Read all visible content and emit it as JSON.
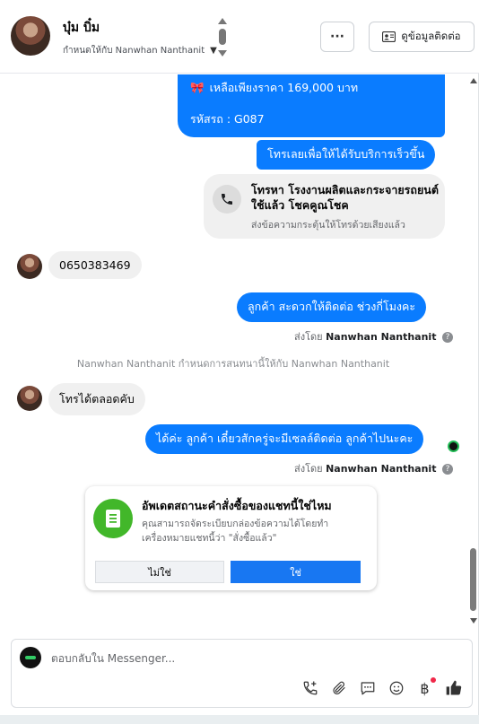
{
  "header": {
    "name": "บุ๋ม บิ๋ม",
    "assigned": "กำหนดให้กับ Nanwhan Nanthanit",
    "more_label": "···",
    "info_label": "ดูข้อมูลติดต่อ"
  },
  "messages": {
    "m1_line1": "เหลือเพียงราคา 169,000 บาท",
    "m1_line2": "รหัสรถ : G087",
    "m2": "โทรเลยเพื่อให้ได้รับบริการเร็วขึ้น",
    "call_title": "โทรหา โรงงานผลิตและกระจายรถยนต์ใช้แล้ว โชคคูณโชค",
    "call_sub": "ส่งข้อความกระตุ้นให้โทรด้วยเสียงแล้ว",
    "in1": "0650383469",
    "out1": "ลูกค้า สะดวกให้ติดต่อ ช่วงกี่โมงคะ",
    "sent_by_label": "ส่งโดย",
    "sent_by_name": "Nanwhan Nanthanit",
    "system_note": "Nanwhan Nanthanit กำหนดการสนทนานี้ให้กับ Nanwhan Nanthanit",
    "in2": "โทรได้ตลอดคับ",
    "out2": "ได้ค่ะ  ลูกค้า เดี๋ยวสักครู่จะมีเซลล์ติดต่อ ลูกค้าไปนะคะ"
  },
  "order_card": {
    "title": "อัพเดตสถานะคำสั่งซื้อของแชทนี้ใช่ไหม",
    "desc": "คุณสามารถจัดระเบียบกล่องข้อความได้โดยทำเครื่องหมายแชทนี้ว่า \"สั่งซื้อแล้ว\"",
    "no_label": "ไม่ใช่",
    "yes_label": "ใช่"
  },
  "composer": {
    "placeholder": "ตอบกลับใน Messenger..."
  },
  "colors": {
    "accent": "#0a7cff",
    "primary_button": "#1877f2",
    "card_icon": "#42b72a"
  }
}
